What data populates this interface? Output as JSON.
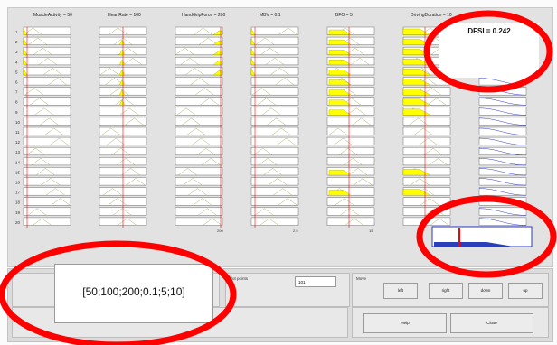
{
  "window": {
    "columns": [
      {
        "header": "MuscleActivity = 50"
      },
      {
        "header": "HeartRate = 100"
      },
      {
        "header": "HandGripForce = 200"
      },
      {
        "header": "MBV = 0.1"
      },
      {
        "header": "BFO = 5"
      },
      {
        "header": "DrivingDuration = 10"
      }
    ],
    "rules": [
      "1",
      "2",
      "3",
      "4",
      "5",
      "6",
      "7",
      "8",
      "9",
      "10",
      "11",
      "12",
      "13",
      "14",
      "15",
      "16",
      "17",
      "18",
      "19",
      "20"
    ],
    "axis_max_labels": [
      "200",
      "2.5",
      "15"
    ]
  },
  "output": {
    "title": "DFSI = 0.242",
    "colors": {
      "fill": "#ffff00",
      "curve": "#2b36c8",
      "marker": "#ff0000",
      "highlight": "#ff0000"
    }
  },
  "input_panel": {
    "value": "[50;100;200;0.1;5;10]"
  },
  "plot_points": {
    "label": "Plot points",
    "value": "101"
  },
  "move_panel": {
    "label": "Move",
    "buttons": [
      "left",
      "right",
      "down",
      "up"
    ]
  },
  "actions": {
    "help_label": "Help",
    "close_label": "Close"
  }
}
